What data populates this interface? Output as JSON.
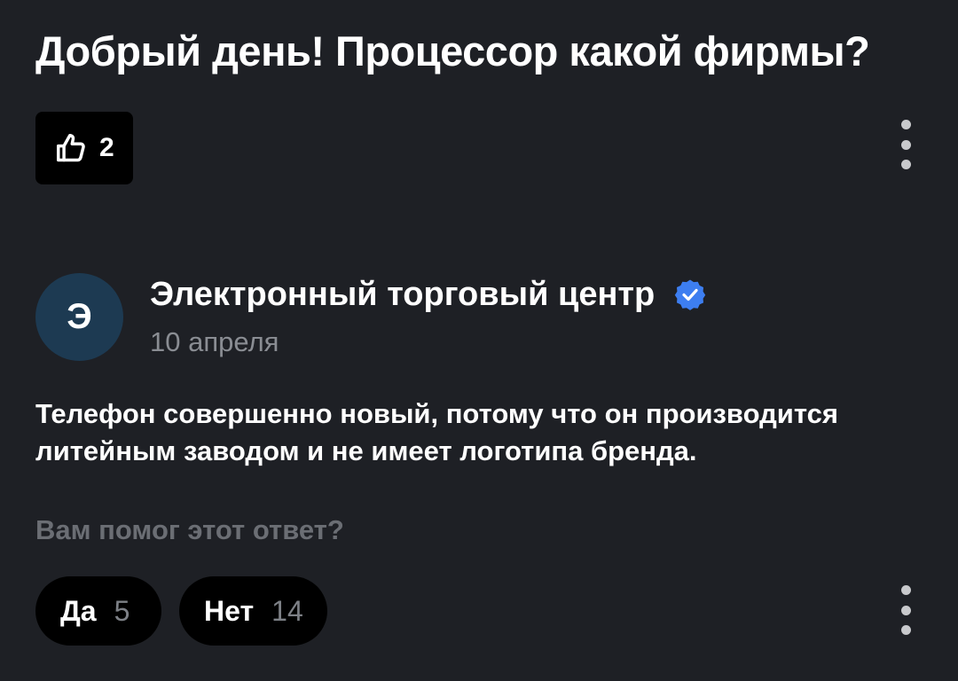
{
  "question": {
    "title": "Добрый день! Процессор какой фирмы?",
    "like_count": "2"
  },
  "answer": {
    "author_initial": "Э",
    "author_name": "Электронный торговый центр",
    "date": "10 апреля",
    "text": "Телефон совершенно новый, потому что он производится литейным заводом и не имеет логотипа бренда.",
    "helpful_prompt": "Вам помог этот ответ?",
    "vote_yes": {
      "label": "Да",
      "count": "5"
    },
    "vote_no": {
      "label": "Нет",
      "count": "14"
    }
  },
  "icons": {
    "like": "thumbs-up-icon",
    "more": "more-vertical-icon",
    "verified": "verified-check-icon"
  },
  "colors": {
    "background": "#1e2025",
    "button_bg": "#000000",
    "avatar_bg": "#1d3a52",
    "verified": "#3d7ef0",
    "muted_text": "#8a8d93"
  }
}
